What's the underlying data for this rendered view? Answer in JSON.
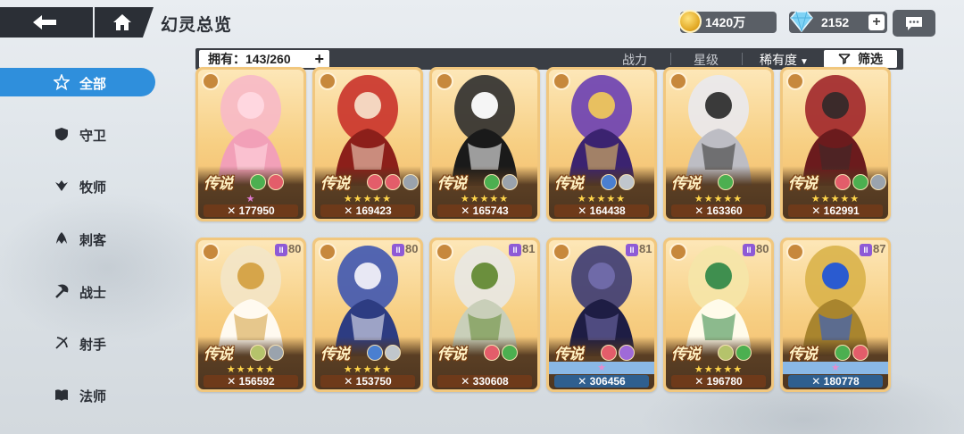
{
  "header": {
    "title": "幻灵总览",
    "gold": "1420万",
    "gems": "2152",
    "plus": "+"
  },
  "filter": {
    "owned": "拥有：143/260",
    "sort_power": "战力",
    "sort_star": "星级",
    "sort_rarity": "稀有度",
    "filter_label": "筛选"
  },
  "sidebar": {
    "items": [
      {
        "label": "全部",
        "icon": "star-outline-icon",
        "active": true
      },
      {
        "label": "守卫",
        "icon": "shield-icon"
      },
      {
        "label": "牧师",
        "icon": "wings-icon"
      },
      {
        "label": "刺客",
        "icon": "claw-icon"
      },
      {
        "label": "战士",
        "icon": "axe-icon"
      },
      {
        "label": "射手",
        "icon": "bow-icon"
      },
      {
        "label": "法师",
        "icon": "book-icon"
      }
    ]
  },
  "cards": [
    {
      "rarity": "传说",
      "power": "177950",
      "stars": "★",
      "level": "",
      "skills": [
        "#4caf50",
        "#e35d6a"
      ]
    },
    {
      "rarity": "传说",
      "power": "169423",
      "stars": "★★★★★",
      "level": "",
      "skills": [
        "#e35d6a",
        "#e35d6a",
        "#9aa3ad"
      ]
    },
    {
      "rarity": "传说",
      "power": "165743",
      "stars": "★★★★★",
      "level": "",
      "skills": [
        "#4caf50",
        "#9aa3ad"
      ]
    },
    {
      "rarity": "传说",
      "power": "164438",
      "stars": "★★★★★",
      "level": "",
      "skills": [
        "#4a7fd0",
        "#c0c6cc"
      ]
    },
    {
      "rarity": "传说",
      "power": "163360",
      "stars": "★★★★★",
      "level": "",
      "skills": [
        "#4caf50"
      ]
    },
    {
      "rarity": "传说",
      "power": "162991",
      "stars": "★★★★★",
      "level": "",
      "skills": [
        "#e35d6a",
        "#4caf50",
        "#9aa3ad"
      ]
    },
    {
      "rarity": "传说",
      "power": "156592",
      "stars": "★★★★★",
      "level": "80",
      "skills": [
        "#b5c36b",
        "#9aa3ad"
      ]
    },
    {
      "rarity": "传说",
      "power": "153750",
      "stars": "★★★★★",
      "level": "80",
      "skills": [
        "#4a7fd0",
        "#c0c6cc"
      ]
    },
    {
      "rarity": "传说",
      "power": "330608",
      "stars": "",
      "level": "81",
      "skills": [
        "#e35d6a",
        "#4caf50"
      ]
    },
    {
      "rarity": "传说",
      "power": "306456",
      "stars": "★",
      "level": "81",
      "skills": [
        "#e35d6a",
        "#9f6ad8"
      ]
    },
    {
      "rarity": "传说",
      "power": "196780",
      "stars": "★★★★★",
      "level": "80",
      "skills": [
        "#b5c36b",
        "#4caf50"
      ]
    },
    {
      "rarity": "传说",
      "power": "180778",
      "stars": "★",
      "level": "87",
      "skills": [
        "#4caf50",
        "#e35d6a"
      ]
    }
  ],
  "colors": {
    "accent": "#2f8fdc",
    "card_frame": "#f1c77e",
    "power_bar": "#6e3a1a"
  }
}
